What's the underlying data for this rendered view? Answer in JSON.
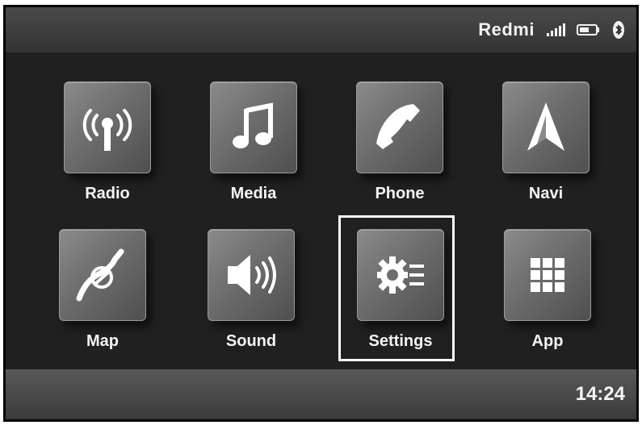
{
  "status_bar": {
    "device_name": "Redmi",
    "icons": [
      "signal-icon",
      "battery-icon",
      "bluetooth-icon"
    ]
  },
  "tiles": [
    {
      "label": "Radio",
      "icon": "radio-antenna-icon"
    },
    {
      "label": "Media",
      "icon": "music-note-icon"
    },
    {
      "label": "Phone",
      "icon": "phone-handset-icon"
    },
    {
      "label": "Navi",
      "icon": "navigation-arrow-icon"
    },
    {
      "label": "Map",
      "icon": "map-route-icon"
    },
    {
      "label": "Sound",
      "icon": "speaker-icon"
    },
    {
      "label": "Settings",
      "icon": "settings-gear-icon",
      "selected": true
    },
    {
      "label": "App",
      "icon": "app-grid-icon"
    }
  ],
  "bottom_bar": {
    "clock": "14:24"
  },
  "colors": {
    "background": "#202020",
    "tile": "#7a7a7a",
    "text": "#f4f4f4",
    "selection": "#ffffff"
  }
}
